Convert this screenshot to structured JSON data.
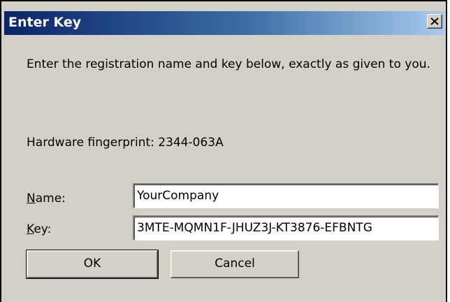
{
  "window": {
    "title": "Enter Key"
  },
  "dialog": {
    "instructions": "Enter the registration name and key below, exactly as given to you.",
    "fingerprint_label": "Hardware fingerprint:",
    "fingerprint_value": "2344-063A",
    "name_label_mnemonic": "N",
    "name_label_rest": "ame:",
    "name_value": "YourCompany",
    "key_label_mnemonic": "K",
    "key_label_rest": "ey:",
    "key_value": "3MTE-MQMN1F-JHUZ3J-KT3876-EFBNTG"
  },
  "buttons": {
    "ok_label": "OK",
    "cancel_label": "Cancel"
  },
  "icons": {
    "close": "close-icon"
  },
  "colors": {
    "title_start": "#0a246a",
    "title_end": "#a6caf0",
    "face": "#d4d0c8"
  }
}
